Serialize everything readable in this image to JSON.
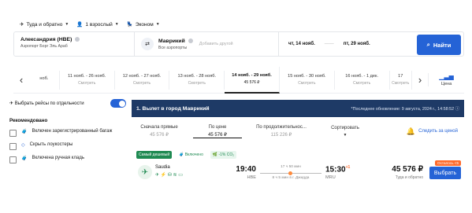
{
  "top_options": {
    "trip_type": "Туда и обратно",
    "passengers": "1 взрослый",
    "cabin": "Эконом"
  },
  "search": {
    "origin_city": "Александрия (HBE)",
    "origin_airport": "Аэропорт Борг Эль Араб",
    "dest_city": "Маврикий",
    "dest_airport": "Все аэропорты",
    "add_other": "Добавить другой",
    "date_from": "чт, 14 нояб.",
    "date_sep": "——",
    "date_to": "пт, 29 нояб.",
    "find_label": "Найти"
  },
  "dates": [
    {
      "d": "ноб.",
      "s": ""
    },
    {
      "d": "11 нояб. - 26 нояб.",
      "s": "Смотреть"
    },
    {
      "d": "12 нояб. - 27 нояб.",
      "s": "Смотреть"
    },
    {
      "d": "13 нояб. - 28 нояб.",
      "s": "Смотреть"
    },
    {
      "d": "14 нояб. - 29 нояб.",
      "s": "45 576 ₽"
    },
    {
      "d": "15 нояб. - 30 нояб.",
      "s": "Смотреть"
    },
    {
      "d": "16 нояб. - 1 дек.",
      "s": "Смотреть"
    },
    {
      "d": "17",
      "s": "Смотреть"
    }
  ],
  "price_tab_label": "Цена",
  "filters": {
    "separate": "Выбрать рейсы по отдельности",
    "recommended": "Рекомендовано",
    "items": [
      "Включен зарегистрированный багаж",
      "Скрыть лоукостеры",
      "Включена ручная кладь"
    ]
  },
  "results_header": {
    "title": "1. Вылет в город Маврикий",
    "updated": "*Последнее обновление: 9 августа, 2024 г., 14:58:52"
  },
  "sort_tabs": [
    {
      "label": "Сначала прямые",
      "price": "45 576 ₽"
    },
    {
      "label": "По цене",
      "price": "45 576 ₽"
    },
    {
      "label": "По продолжительнос...",
      "price": "115 226 ₽"
    },
    {
      "label": "Сортировать",
      "price": ""
    }
  ],
  "track_label": "Следить за ценой",
  "flight": {
    "tag_cheapest": "Самый дешевый",
    "tag_included": "Включено",
    "tag_co2": "-1% CO₂",
    "airline": "Saudia",
    "dep_time": "19:40",
    "dep_code": "HBE",
    "duration": "17 ч 50 мин",
    "stops": "8 ч 5 мин в г. Джидда",
    "arr_time": "15:30",
    "arr_day": "+1",
    "arr_code": "MRU",
    "price": "45 576 ₽",
    "price_note": "Туда и обратно",
    "left_badge": "Осталось <5",
    "select": "Выбрать"
  },
  "colors": {
    "accent": "#2563d6",
    "header": "#1e3a66",
    "badge": "#ff6b2c",
    "tag_green": "#1f8a52"
  }
}
